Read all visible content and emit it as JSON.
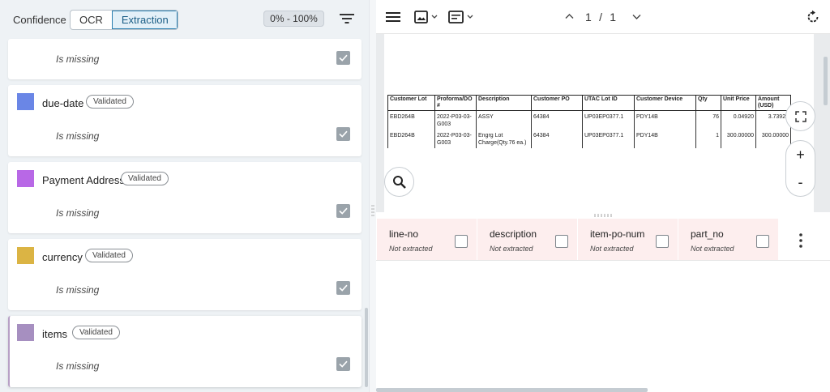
{
  "left_toolbar": {
    "label": "Confidence",
    "tabs": [
      {
        "label": "OCR",
        "active": false
      },
      {
        "label": "Extraction",
        "active": true
      }
    ],
    "range": "0% - 100%",
    "filter_icon": "filter-icon"
  },
  "fields": [
    {
      "name": "",
      "badge": "",
      "value": "Is missing",
      "checked": true
    },
    {
      "name": "due-date",
      "badge": "Validated",
      "value": "Is missing",
      "color": "#6a86e6",
      "checked": true
    },
    {
      "name": "Payment Address",
      "badge": "Validated",
      "value": "Is missing",
      "color": "#b868e6",
      "checked": true
    },
    {
      "name": "currency",
      "badge": "Validated",
      "value": "Is missing",
      "color": "#dbb444",
      "checked": true
    },
    {
      "name": "items",
      "badge": "Validated",
      "value": "Is missing",
      "color": "#a68fc0",
      "checked": true,
      "selected": true
    }
  ],
  "viewer": {
    "current_page": "1",
    "separator": "/",
    "total_pages": "1",
    "icons": [
      "menu-icon",
      "image-icon",
      "text-layout-icon",
      "chevron-up-icon",
      "chevron-down-icon",
      "refresh-icon"
    ]
  },
  "document": {
    "headers": [
      "Customer Lot",
      "Proforma/DO #",
      "Description",
      "Customer PO",
      "UTAC Lot ID",
      "Customer Device",
      "Qty",
      "Unit Price",
      "Amount (USD)"
    ],
    "rows": [
      [
        "EBD264B",
        "2022-P03-03-G003",
        "ASSY",
        "64384",
        "UP03EP0377.1",
        "PDY14B",
        "76",
        "0.04920",
        "3.73920"
      ],
      [
        "EBD264B",
        "2022-P03-03-G003",
        "Engrg Lot Charge(Qty.76 ea.)",
        "64384",
        "UP03EP0377.1",
        "PDY14B",
        "1",
        "300.00000",
        "300.00000"
      ]
    ]
  },
  "zoom": {
    "in": "+",
    "out": "-"
  },
  "items_columns": [
    {
      "name": "line-no",
      "status": "Not extracted"
    },
    {
      "name": "description",
      "status": "Not extracted"
    },
    {
      "name": "item-po-num",
      "status": "Not extracted"
    },
    {
      "name": "part_no",
      "status": "Not extracted"
    }
  ]
}
